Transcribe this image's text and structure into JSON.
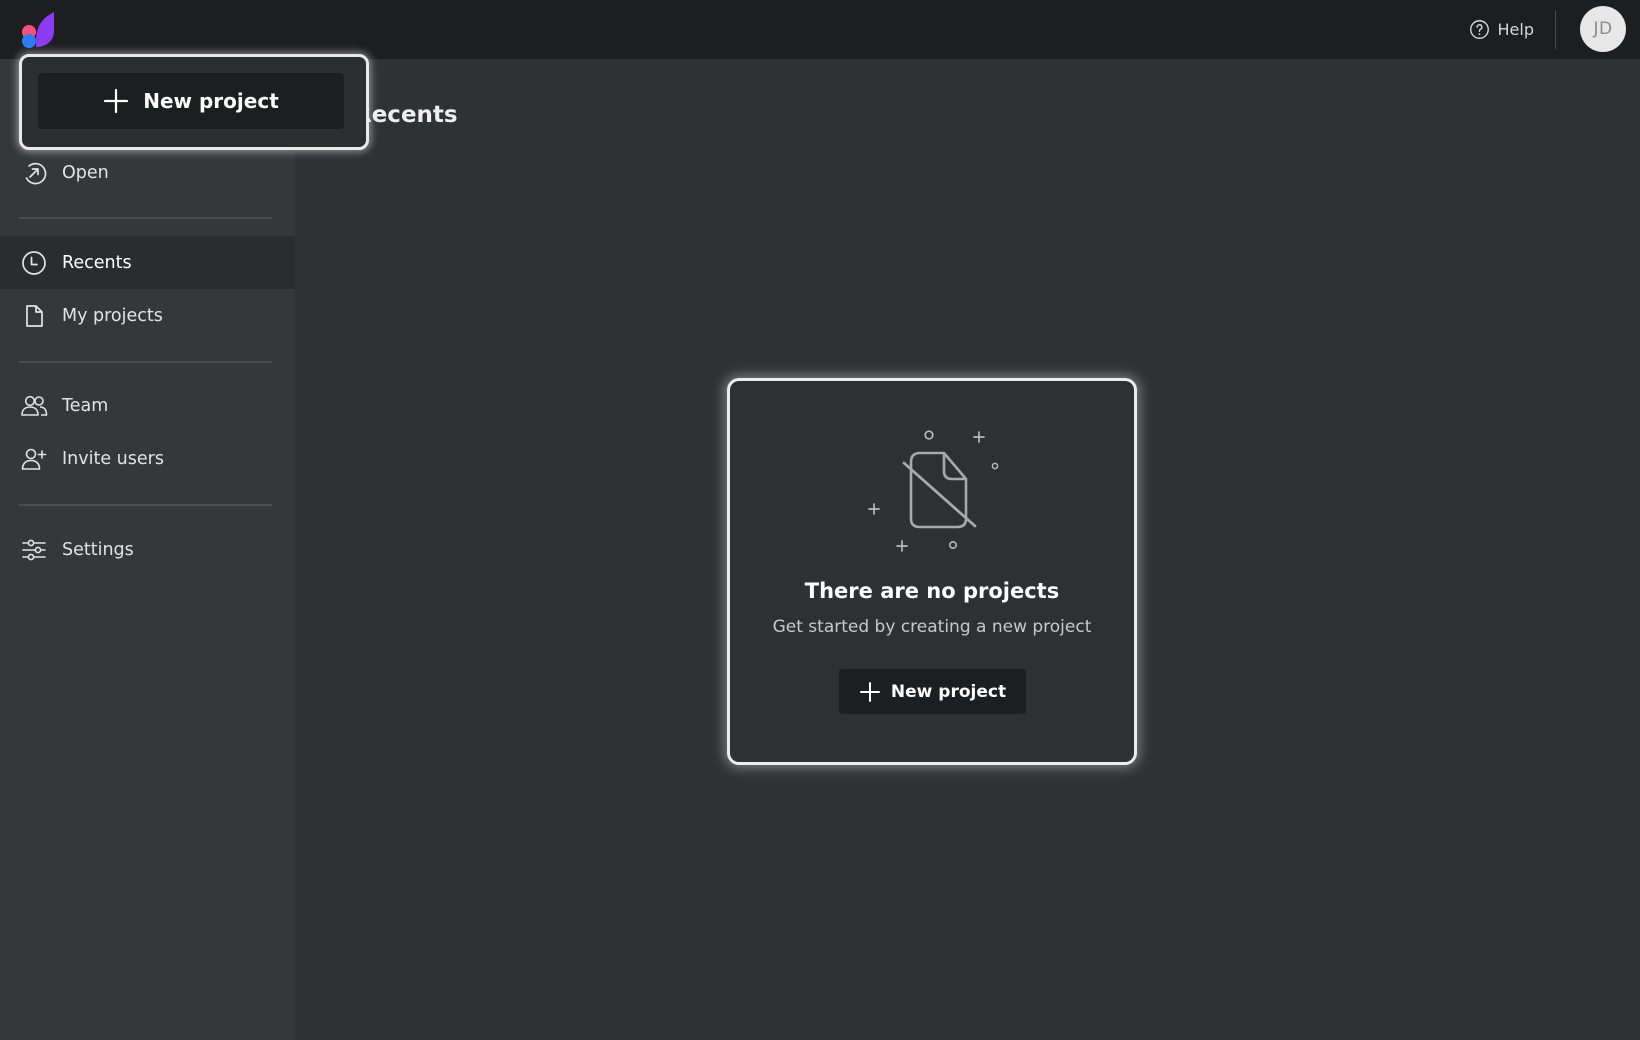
{
  "topbar": {
    "help_label": "Help",
    "avatar_initials": "JD"
  },
  "brand": {
    "colors": {
      "pink": "#ff4f7b",
      "blue": "#2d7cf6",
      "purple": "#8b3cf2"
    }
  },
  "highlight": {
    "new_project_label": "New project"
  },
  "sidebar": {
    "items": [
      {
        "label": "Open",
        "icon": "open-arrow-icon"
      },
      {
        "label": "Recents",
        "icon": "clock-icon",
        "active": true
      },
      {
        "label": "My projects",
        "icon": "file-icon"
      },
      {
        "label": "Team",
        "icon": "team-icon"
      },
      {
        "label": "Invite users",
        "icon": "user-plus-icon"
      },
      {
        "label": "Settings",
        "icon": "sliders-icon"
      }
    ]
  },
  "main": {
    "title": "Recents"
  },
  "empty_state": {
    "title": "There are no projects",
    "subtitle": "Get started by creating a new project",
    "button_label": "New project",
    "icon": "no-file-icon"
  }
}
